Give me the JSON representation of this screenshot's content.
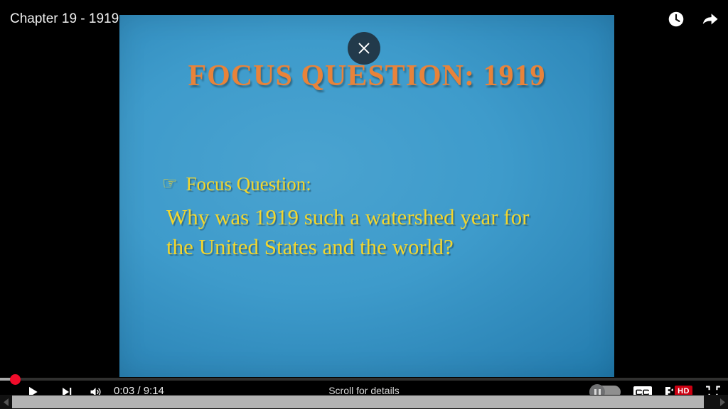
{
  "player": {
    "video_title": "Chapter 19 - 1919",
    "close_label": "×",
    "scroll_hint": "Scroll for details",
    "top_actions": [
      {
        "name": "watch-later-icon",
        "label": "Watch later"
      },
      {
        "name": "share-icon",
        "label": "Share"
      }
    ]
  },
  "slide": {
    "title": "FOCUS QUESTION: 1919",
    "bullet_glyph": "☞",
    "bullet_label": "Focus Question:",
    "question_line1": "Why was 1919 such a watershed year for",
    "question_line2": "the United States and the world?",
    "title_color": "#e8833a",
    "text_color": "#f2d62e",
    "background_color": "#2b84b6"
  },
  "controls": {
    "play_label": "Play",
    "next_label": "Next video",
    "volume_label": "Mute",
    "current_time": "0:03",
    "duration": "9:14",
    "time_display": "0:03 / 9:14",
    "autoplay_label": "Autoplay",
    "cc_label": "CC",
    "quality_label": "HD",
    "collapse_label": "Exit fullscreen",
    "progress_percent": 0.5,
    "accent_color": "#f00c2a",
    "hd_badge_color": "#cc0011"
  },
  "scrollbar": {
    "left_arrow": "◀",
    "right_arrow": "▶"
  }
}
